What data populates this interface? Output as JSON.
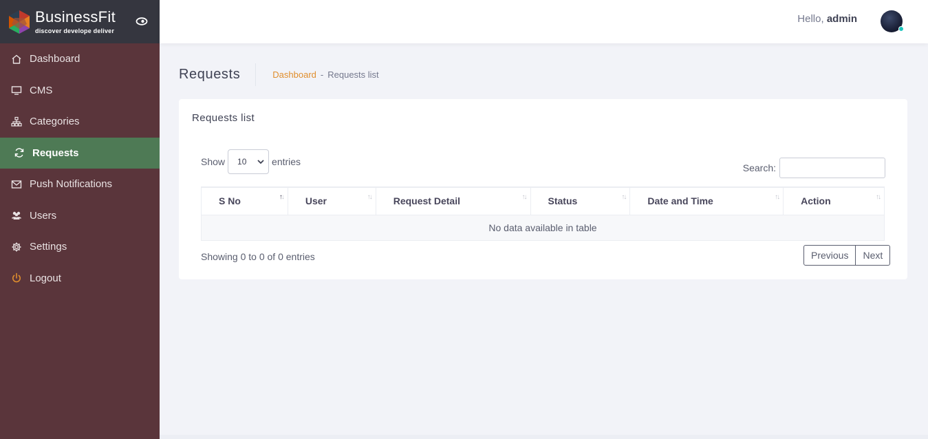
{
  "brand": {
    "name": "BusinessFit",
    "tagline": "discover develope deliver"
  },
  "sidebar": {
    "items": [
      {
        "label": "Dashboard",
        "icon": "home-icon"
      },
      {
        "label": "CMS",
        "icon": "monitor-icon"
      },
      {
        "label": "Categories",
        "icon": "sitemap-icon"
      },
      {
        "label": "Requests",
        "icon": "refresh-icon",
        "active": true
      },
      {
        "label": "Push Notifications",
        "icon": "mail-icon"
      },
      {
        "label": "Users",
        "icon": "users-icon"
      },
      {
        "label": "Settings",
        "icon": "gear-icon"
      },
      {
        "label": "Logout",
        "icon": "power-icon"
      }
    ]
  },
  "header": {
    "greeting": "Hello,",
    "username": "admin"
  },
  "subheader": {
    "title": "Requests",
    "breadcrumb_link": "Dashboard",
    "breadcrumb_sep": "-",
    "breadcrumb_current": "Requests list"
  },
  "card": {
    "title": "Requests list",
    "show_label": "Show",
    "entries_label": "entries",
    "page_length": "10",
    "search_label": "Search:",
    "search_value": "",
    "columns": [
      "S No",
      "User",
      "Request Detail",
      "Status",
      "Date and Time",
      "Action"
    ],
    "empty_message": "No data available in table",
    "info": "Showing 0 to 0 of 0 entries",
    "prev_label": "Previous",
    "next_label": "Next"
  },
  "colors": {
    "sidebar_bg": "#5a353b",
    "brand_bg": "#35363f",
    "active_bg": "#4e7a55",
    "accent": "#e08e2d",
    "online": "#1bc5bd"
  }
}
